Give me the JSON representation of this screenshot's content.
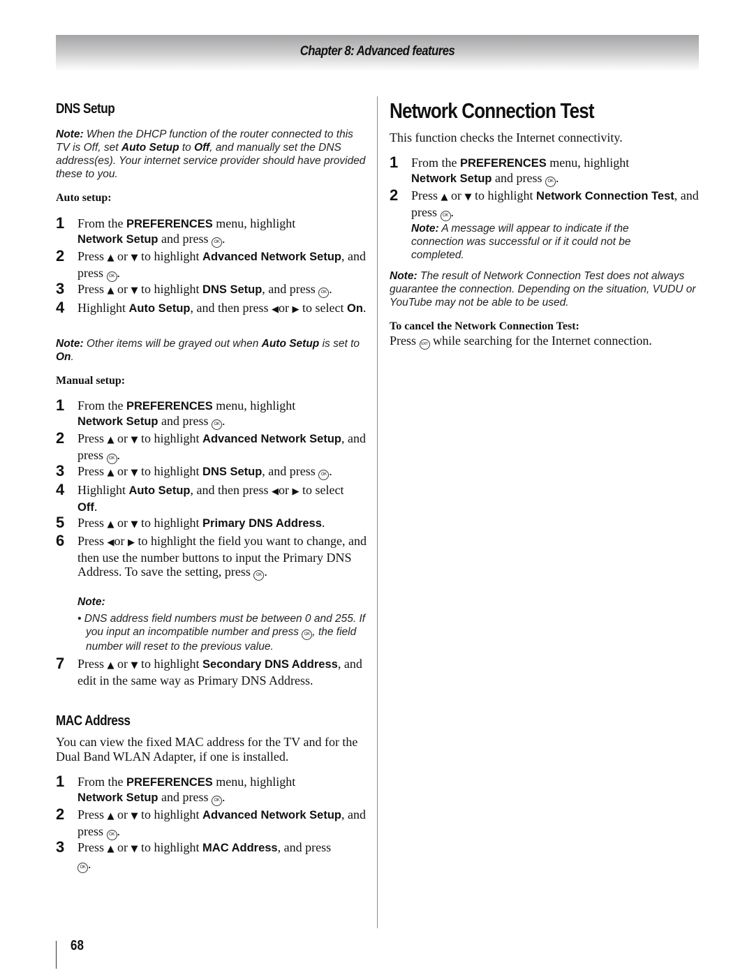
{
  "header": {
    "chapter": "Chapter 8: Advanced features"
  },
  "dns_setup": {
    "title": "DNS Setup",
    "note": {
      "label": "Note:",
      "t1": " When the DHCP function of the router connected to this TV is Off, set ",
      "b1": "Auto Setup",
      "t2": " to ",
      "b2": "Off",
      "t3": ", and manually set the DNS address(es). Your internet service provider should have provided these to you."
    },
    "auto_setup": {
      "heading": "Auto setup:",
      "steps": [
        {
          "num": "1",
          "t1": "From the ",
          "b1": "PREFERENCES",
          "t2": " menu, highlight ",
          "b2": "Network Setup",
          "t3": " and press ",
          "t4": "."
        },
        {
          "num": "2",
          "t1": "Press ",
          "t2": " or ",
          "t3": " to highlight ",
          "b1": "Advanced Network Setup",
          "t4": ", and press ",
          "t5": "."
        },
        {
          "num": "3",
          "t1": "Press ",
          "t2": " or ",
          "t3": " to highlight ",
          "b1": "DNS Setup",
          "t4": ", and press ",
          "t5": "."
        },
        {
          "num": "4",
          "t1": "Highlight ",
          "b1": "Auto Setup",
          "t2": ", and then press ",
          "t3": "or ",
          "t4": " to select ",
          "b2": "On",
          "t5": "."
        }
      ],
      "note": {
        "label": "Note:",
        "t1": " Other items will be grayed out when ",
        "b1": "Auto Setup",
        "t2": " is set to ",
        "b2": "On",
        "t3": "."
      }
    },
    "manual_setup": {
      "heading": "Manual setup:",
      "steps": [
        {
          "num": "1",
          "t1": "From the ",
          "b1": "PREFERENCES",
          "t2": " menu, highlight ",
          "b2": "Network Setup",
          "t3": " and press ",
          "t4": "."
        },
        {
          "num": "2",
          "t1": "Press ",
          "t2": " or ",
          "t3": " to highlight ",
          "b1": "Advanced Network Setup",
          "t4": ", and press ",
          "t5": "."
        },
        {
          "num": "3",
          "t1": "Press ",
          "t2": " or ",
          "t3": " to highlight ",
          "b1": "DNS Setup",
          "t4": ", and press ",
          "t5": "."
        },
        {
          "num": "4",
          "t1": "Highlight ",
          "b1": "Auto Setup",
          "t2": ", and then press ",
          "t3": "or ",
          "t4": " to select ",
          "b2": "Off",
          "t5": "."
        },
        {
          "num": "5",
          "t1": "Press ",
          "t2": " or ",
          "t3": " to highlight ",
          "b1": "Primary DNS Address",
          "t4": "."
        },
        {
          "num": "6",
          "t1": "Press ",
          "t2": "or ",
          "t3": " to highlight the field you want to change, and then use the number buttons to input the Primary DNS Address. To save the setting, press ",
          "t4": "."
        },
        {
          "num": "7",
          "t1": "Press ",
          "t2": " or ",
          "t3": " to highlight ",
          "b1": "Secondary DNS Address",
          "t4": ", and edit in the same way as Primary DNS Address."
        }
      ],
      "step6_note": {
        "label": "Note:",
        "bullet": "•",
        "t1": " DNS address field numbers must be between 0 and 255. If you input an incompatible number and press ",
        "t2": ", the field number will reset to the previous value."
      }
    }
  },
  "mac_address": {
    "title": "MAC Address",
    "intro": "You can view the fixed MAC address for the TV and for the Dual Band WLAN Adapter, if one is installed.",
    "steps": [
      {
        "num": "1",
        "t1": "From the ",
        "b1": "PREFERENCES",
        "t2": " menu, highlight ",
        "b2": "Network Setup",
        "t3": " and press ",
        "t4": "."
      },
      {
        "num": "2",
        "t1": "Press ",
        "t2": " or ",
        "t3": " to highlight ",
        "b1": "Advanced Network Setup",
        "t4": ", and press ",
        "t5": "."
      },
      {
        "num": "3",
        "t1": "Press ",
        "t2": " or ",
        "t3": " to highlight ",
        "b1": "MAC Address",
        "t4": ", and press ",
        "t5": "."
      }
    ]
  },
  "network_test": {
    "title": "Network Connection Test",
    "intro": "This function checks the Internet connectivity.",
    "steps": [
      {
        "num": "1",
        "t1": "From the ",
        "b1": "PREFERENCES",
        "t2": " menu, highlight ",
        "b2": "Network Setup",
        "t3": " and press ",
        "t4": "."
      },
      {
        "num": "2",
        "t1": "Press ",
        "t2": " or ",
        "t3": " to highlight ",
        "b1": "Network Connection Test",
        "t4": ", and press ",
        "t5": "."
      }
    ],
    "step2_note": {
      "label": "Note:",
      "text": " A message will appear to indicate if the connection was successful or if it could not be completed."
    },
    "note": {
      "label": "Note:",
      "text": " The result of Network Connection Test does not always guarantee the connection. Depending on the situation, VUDU or YouTube may not be able to be used."
    },
    "cancel": {
      "heading": "To cancel the Network Connection Test:",
      "t1": "Press ",
      "t2": " while searching for the Internet connection."
    }
  },
  "icons": {
    "ok": "OK",
    "exit": "EXIT",
    "up": "▲",
    "down": "▼",
    "left": "◀",
    "right": "▶"
  },
  "footer": {
    "page_number": "68"
  }
}
